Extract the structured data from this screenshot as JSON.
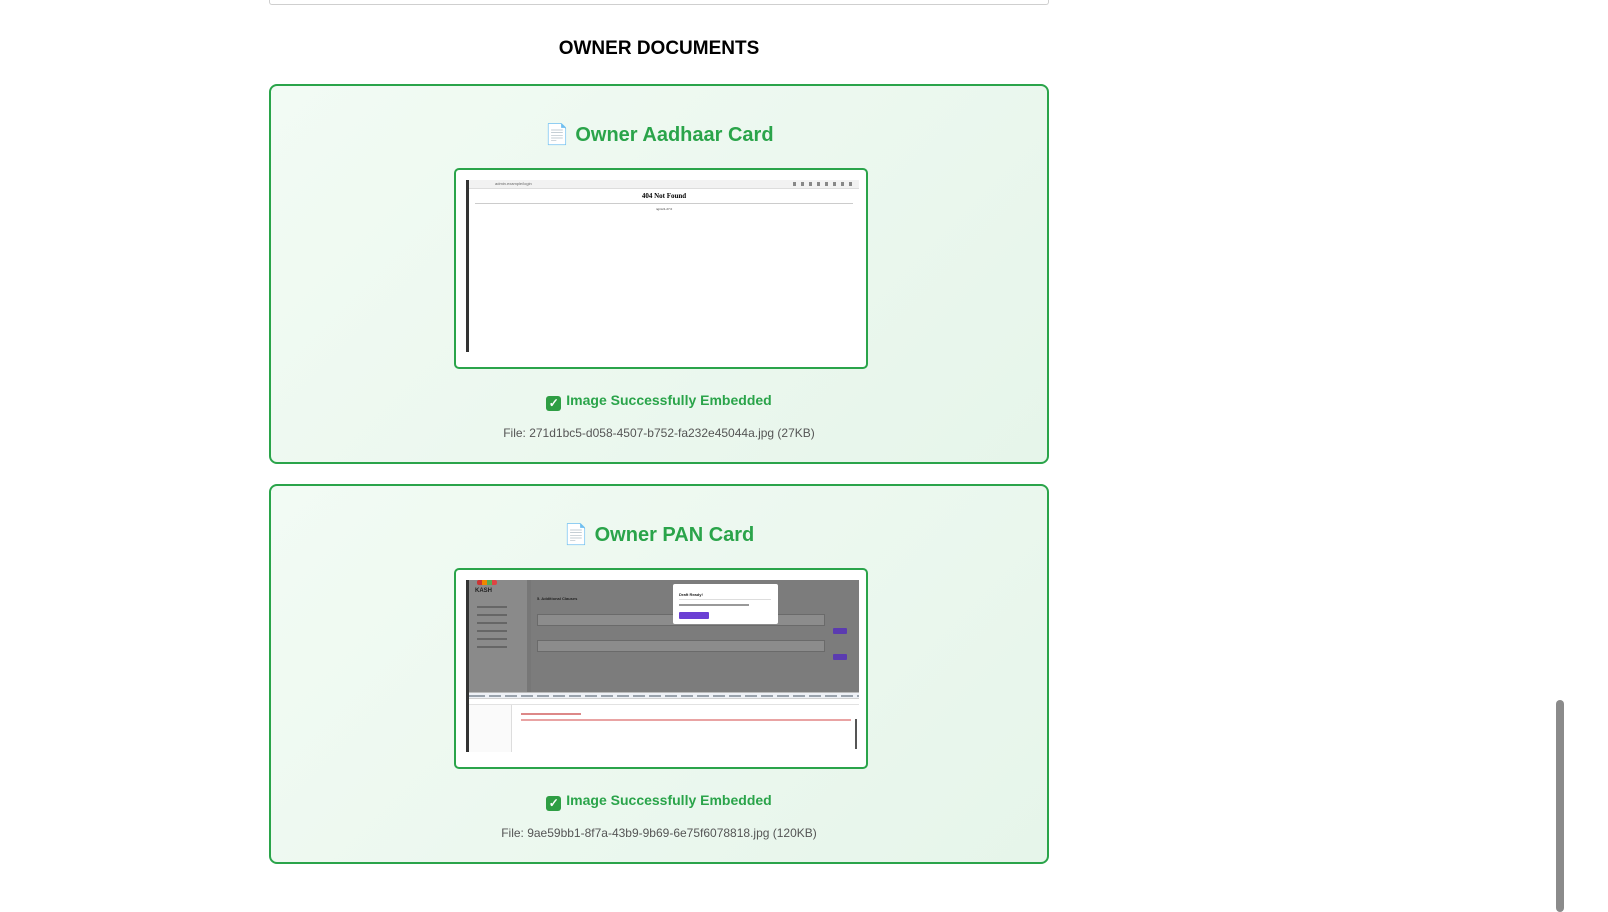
{
  "section_title": "OWNER DOCUMENTS",
  "documents": [
    {
      "icon": "document-icon",
      "icon_glyph": "📄",
      "title": "Owner Aadhaar Card",
      "status_glyph": "✓",
      "status": "Image Successfully Embedded",
      "file": "File: 271d1bc5-d058-4507-b752-fa232e45044a.jpg (27KB)",
      "preview": {
        "heading": "404 Not Found",
        "server": "nginx/1.27.0",
        "url": "admin.example/login"
      }
    },
    {
      "icon": "document-icon",
      "icon_glyph": "📄",
      "title": "Owner PAN Card",
      "status_glyph": "✓",
      "status": "Image Successfully Embedded",
      "file": "File: 9ae59bb1-8f7a-43b9-9b69-6e75f6078818.jpg (120KB)",
      "preview": {
        "logo": "KASH",
        "section": "5. Additional Clauses",
        "modal_title": "Draft Ready!",
        "modal_button": "Download Draft"
      }
    }
  ],
  "colors": {
    "accent_green": "#2aa44a",
    "card_background": "#eef8f0"
  }
}
